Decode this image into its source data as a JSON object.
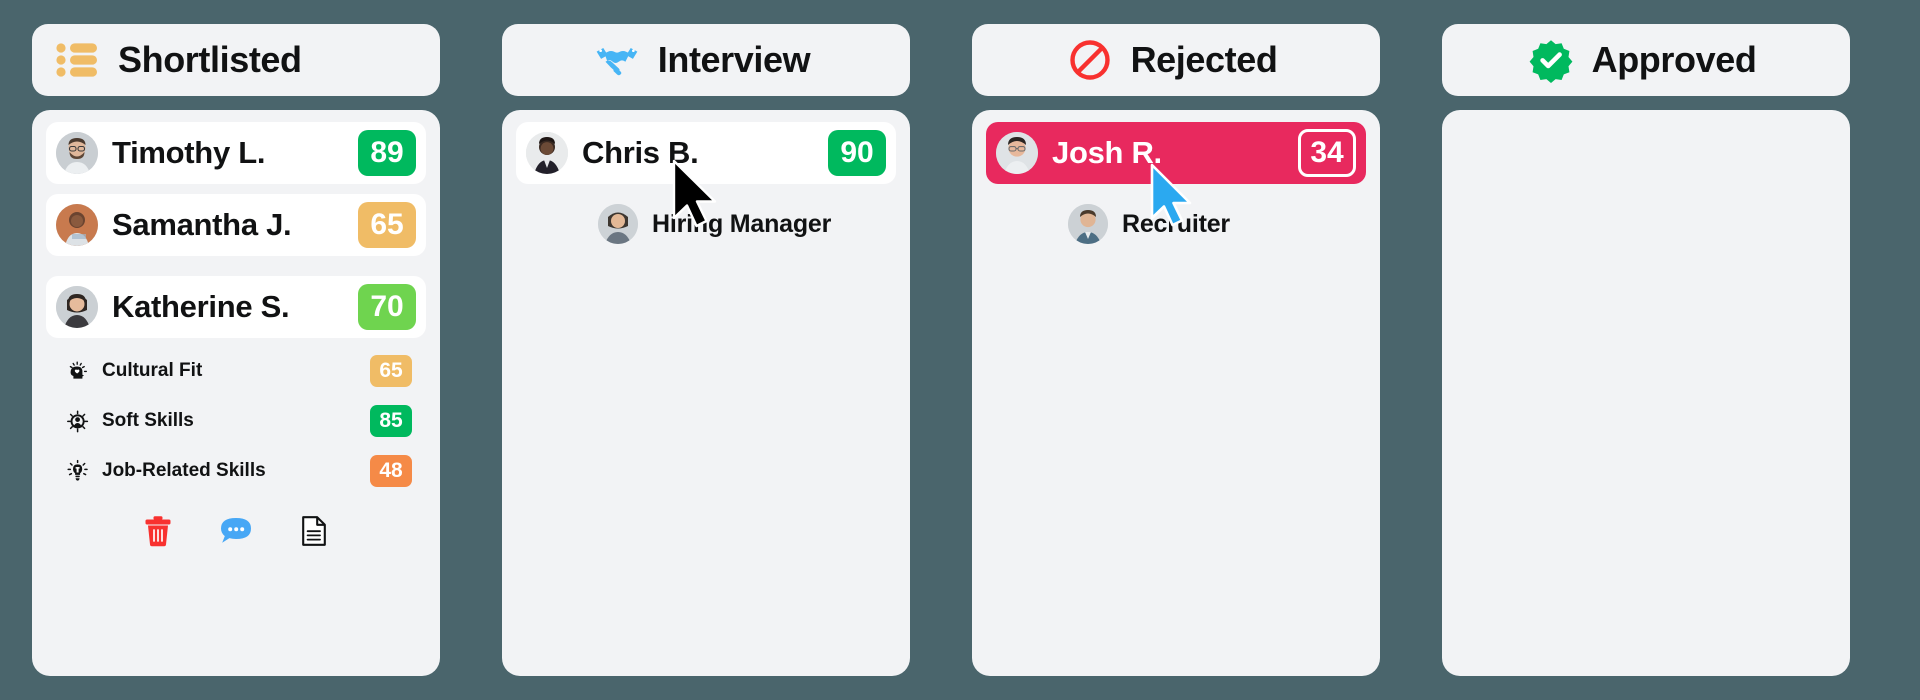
{
  "board": {
    "background_color": "#4a656c",
    "columns": [
      {
        "id": "shortlisted",
        "title": "Shortlisted",
        "icon": "list-icon",
        "icon_color": "#f0bc66",
        "candidates": [
          {
            "name": "Timothy L.",
            "score": "89",
            "score_color": "#00b95e",
            "avatar": "avatar-timothy",
            "expanded": false,
            "highlighted": false
          },
          {
            "name": "Samantha J.",
            "score": "65",
            "score_color": "#f0bc66",
            "avatar": "avatar-samantha",
            "expanded": false,
            "highlighted": false
          },
          {
            "name": "Katherine S.",
            "score": "70",
            "score_color": "#6fd44f",
            "avatar": "avatar-katherine",
            "expanded": true,
            "highlighted": false,
            "skills": [
              {
                "label": "Cultural Fit",
                "icon": "head-heart-icon",
                "score": "65",
                "score_color": "#f0bc66"
              },
              {
                "label": "Soft Skills",
                "icon": "person-radiate-icon",
                "score": "85",
                "score_color": "#00b95e"
              },
              {
                "label": "Job-Related Skills",
                "icon": "lightbulb-icon",
                "score": "48",
                "score_color": "#f58a47"
              }
            ],
            "actions": [
              {
                "name": "delete-button",
                "icon": "trash-icon",
                "color": "#f8312f"
              },
              {
                "name": "comment-button",
                "icon": "chat-bubble-icon",
                "color": "#47a7f5"
              },
              {
                "name": "document-button",
                "icon": "document-icon",
                "color": "#111213"
              }
            ]
          }
        ]
      },
      {
        "id": "interview",
        "title": "Interview",
        "icon": "handshake-icon",
        "icon_color": "#47b5f5",
        "candidates": [
          {
            "name": "Chris B.",
            "score": "90",
            "score_color": "#00b95e",
            "avatar": "avatar-chris",
            "expanded": false,
            "highlighted": false
          }
        ],
        "assignee": {
          "label": "Hiring Manager",
          "avatar": "avatar-hiring-manager"
        },
        "cursor": "black-pointer"
      },
      {
        "id": "rejected",
        "title": "Rejected",
        "icon": "no-entry-icon",
        "icon_color": "#f8312f",
        "candidates": [
          {
            "name": "Josh R.",
            "score": "34",
            "score_color": "#e8295e",
            "avatar": "avatar-josh",
            "expanded": false,
            "highlighted": true,
            "highlight_color": "#e8295e"
          }
        ],
        "assignee": {
          "label": "Recruiter",
          "avatar": "avatar-recruiter"
        },
        "cursor": "blue-pointer"
      },
      {
        "id": "approved",
        "title": "Approved",
        "icon": "verified-check-icon",
        "icon_color": "#00b95e",
        "candidates": []
      }
    ]
  }
}
